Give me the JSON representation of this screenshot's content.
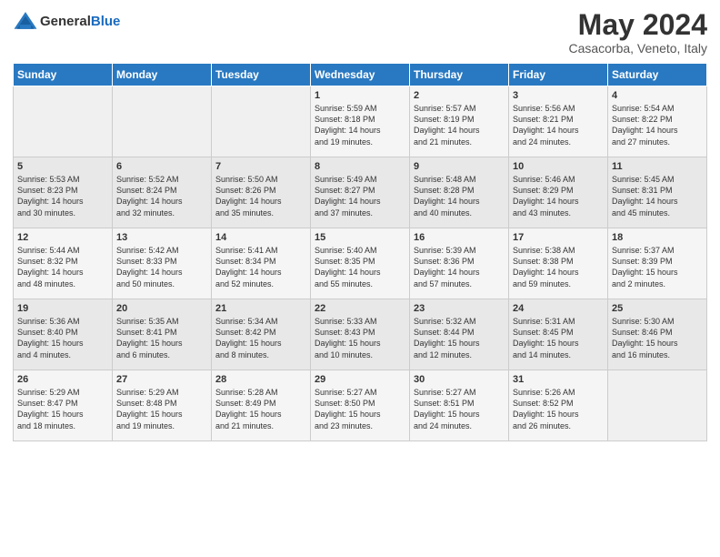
{
  "header": {
    "logo_line1": "General",
    "logo_line2": "Blue",
    "month": "May 2024",
    "location": "Casacorba, Veneto, Italy"
  },
  "days_of_week": [
    "Sunday",
    "Monday",
    "Tuesday",
    "Wednesday",
    "Thursday",
    "Friday",
    "Saturday"
  ],
  "weeks": [
    [
      {
        "day": "",
        "data": ""
      },
      {
        "day": "",
        "data": ""
      },
      {
        "day": "",
        "data": ""
      },
      {
        "day": "1",
        "data": "Sunrise: 5:59 AM\nSunset: 8:18 PM\nDaylight: 14 hours\nand 19 minutes."
      },
      {
        "day": "2",
        "data": "Sunrise: 5:57 AM\nSunset: 8:19 PM\nDaylight: 14 hours\nand 21 minutes."
      },
      {
        "day": "3",
        "data": "Sunrise: 5:56 AM\nSunset: 8:21 PM\nDaylight: 14 hours\nand 24 minutes."
      },
      {
        "day": "4",
        "data": "Sunrise: 5:54 AM\nSunset: 8:22 PM\nDaylight: 14 hours\nand 27 minutes."
      }
    ],
    [
      {
        "day": "5",
        "data": "Sunrise: 5:53 AM\nSunset: 8:23 PM\nDaylight: 14 hours\nand 30 minutes."
      },
      {
        "day": "6",
        "data": "Sunrise: 5:52 AM\nSunset: 8:24 PM\nDaylight: 14 hours\nand 32 minutes."
      },
      {
        "day": "7",
        "data": "Sunrise: 5:50 AM\nSunset: 8:26 PM\nDaylight: 14 hours\nand 35 minutes."
      },
      {
        "day": "8",
        "data": "Sunrise: 5:49 AM\nSunset: 8:27 PM\nDaylight: 14 hours\nand 37 minutes."
      },
      {
        "day": "9",
        "data": "Sunrise: 5:48 AM\nSunset: 8:28 PM\nDaylight: 14 hours\nand 40 minutes."
      },
      {
        "day": "10",
        "data": "Sunrise: 5:46 AM\nSunset: 8:29 PM\nDaylight: 14 hours\nand 43 minutes."
      },
      {
        "day": "11",
        "data": "Sunrise: 5:45 AM\nSunset: 8:31 PM\nDaylight: 14 hours\nand 45 minutes."
      }
    ],
    [
      {
        "day": "12",
        "data": "Sunrise: 5:44 AM\nSunset: 8:32 PM\nDaylight: 14 hours\nand 48 minutes."
      },
      {
        "day": "13",
        "data": "Sunrise: 5:42 AM\nSunset: 8:33 PM\nDaylight: 14 hours\nand 50 minutes."
      },
      {
        "day": "14",
        "data": "Sunrise: 5:41 AM\nSunset: 8:34 PM\nDaylight: 14 hours\nand 52 minutes."
      },
      {
        "day": "15",
        "data": "Sunrise: 5:40 AM\nSunset: 8:35 PM\nDaylight: 14 hours\nand 55 minutes."
      },
      {
        "day": "16",
        "data": "Sunrise: 5:39 AM\nSunset: 8:36 PM\nDaylight: 14 hours\nand 57 minutes."
      },
      {
        "day": "17",
        "data": "Sunrise: 5:38 AM\nSunset: 8:38 PM\nDaylight: 14 hours\nand 59 minutes."
      },
      {
        "day": "18",
        "data": "Sunrise: 5:37 AM\nSunset: 8:39 PM\nDaylight: 15 hours\nand 2 minutes."
      }
    ],
    [
      {
        "day": "19",
        "data": "Sunrise: 5:36 AM\nSunset: 8:40 PM\nDaylight: 15 hours\nand 4 minutes."
      },
      {
        "day": "20",
        "data": "Sunrise: 5:35 AM\nSunset: 8:41 PM\nDaylight: 15 hours\nand 6 minutes."
      },
      {
        "day": "21",
        "data": "Sunrise: 5:34 AM\nSunset: 8:42 PM\nDaylight: 15 hours\nand 8 minutes."
      },
      {
        "day": "22",
        "data": "Sunrise: 5:33 AM\nSunset: 8:43 PM\nDaylight: 15 hours\nand 10 minutes."
      },
      {
        "day": "23",
        "data": "Sunrise: 5:32 AM\nSunset: 8:44 PM\nDaylight: 15 hours\nand 12 minutes."
      },
      {
        "day": "24",
        "data": "Sunrise: 5:31 AM\nSunset: 8:45 PM\nDaylight: 15 hours\nand 14 minutes."
      },
      {
        "day": "25",
        "data": "Sunrise: 5:30 AM\nSunset: 8:46 PM\nDaylight: 15 hours\nand 16 minutes."
      }
    ],
    [
      {
        "day": "26",
        "data": "Sunrise: 5:29 AM\nSunset: 8:47 PM\nDaylight: 15 hours\nand 18 minutes."
      },
      {
        "day": "27",
        "data": "Sunrise: 5:29 AM\nSunset: 8:48 PM\nDaylight: 15 hours\nand 19 minutes."
      },
      {
        "day": "28",
        "data": "Sunrise: 5:28 AM\nSunset: 8:49 PM\nDaylight: 15 hours\nand 21 minutes."
      },
      {
        "day": "29",
        "data": "Sunrise: 5:27 AM\nSunset: 8:50 PM\nDaylight: 15 hours\nand 23 minutes."
      },
      {
        "day": "30",
        "data": "Sunrise: 5:27 AM\nSunset: 8:51 PM\nDaylight: 15 hours\nand 24 minutes."
      },
      {
        "day": "31",
        "data": "Sunrise: 5:26 AM\nSunset: 8:52 PM\nDaylight: 15 hours\nand 26 minutes."
      },
      {
        "day": "",
        "data": ""
      }
    ]
  ]
}
